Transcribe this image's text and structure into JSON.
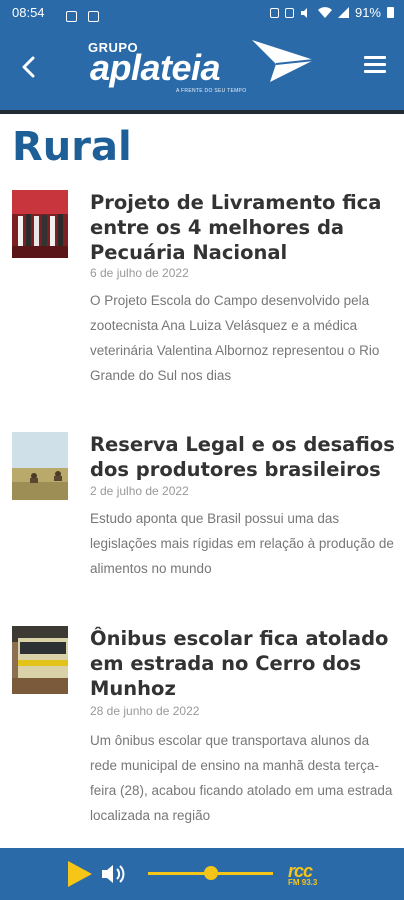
{
  "status": {
    "time": "08:54",
    "battery": "91%"
  },
  "header": {
    "logo_prefix": "GRUPO",
    "logo_name": "aplateia",
    "logo_tagline": "A FRENTE DO SEU TEMPO"
  },
  "section": {
    "title": "Rural"
  },
  "articles": [
    {
      "title": "Projeto de Livramento fica entre os 4 melhores da Pecuária Nacional",
      "date": "6 de julho de 2022",
      "excerpt": "O Projeto Escola do Campo desenvolvido pela zootecnista Ana Luiza Velásquez e a médica veterinária Valentina Albornoz representou o Rio Grande do Sul nos dias"
    },
    {
      "title": "Reserva Legal e os desafios dos produtores brasileiros",
      "date": "2 de julho de 2022",
      "excerpt": "Estudo aponta que Brasil possui uma das legislações mais rígidas em relação à produção de alimentos no mundo"
    },
    {
      "title": "Ônibus escolar fica atolado em estrada no Cerro dos Munhoz",
      "date": "28 de junho de 2022",
      "excerpt": "Um ônibus escolar que transportava alunos da rede municipal de ensino na manhã desta terça-feira (28), acabou ficando atolado em uma estrada localizada na região"
    }
  ],
  "player": {
    "radio_name": "rcc",
    "radio_freq": "FM 93.3",
    "volume_fraction": 0.5,
    "accent_color": "#f5c518"
  },
  "colors": {
    "brand": "#2a6aa8",
    "section_title": "#1e5f98"
  }
}
